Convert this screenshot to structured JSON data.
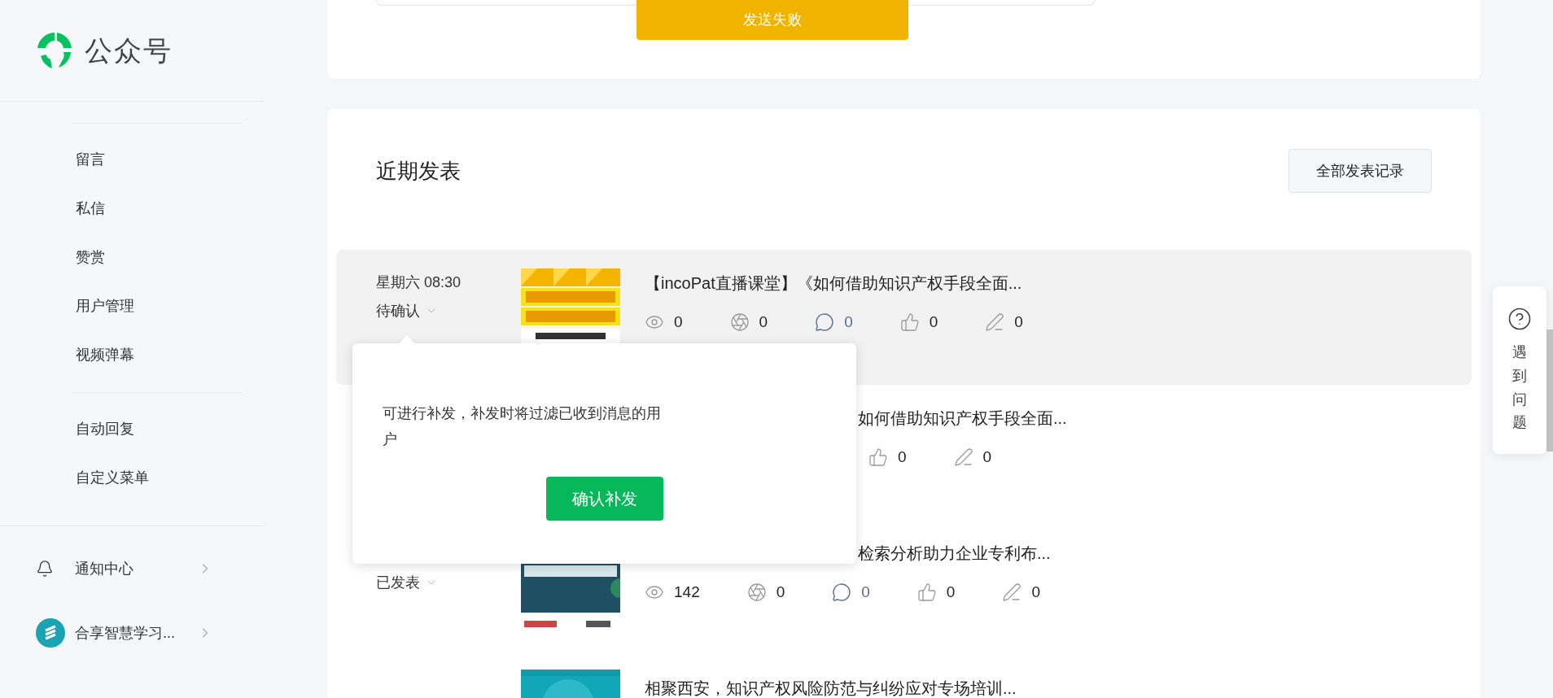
{
  "sidebar": {
    "brand": "公众号",
    "nav_groups": [
      {
        "items": [
          "留言",
          "私信",
          "赞赏",
          "用户管理",
          "视频弹幕"
        ]
      },
      {
        "items": [
          "自动回复",
          "自定义菜单"
        ]
      }
    ],
    "footer": [
      {
        "kind": "bell",
        "label": "通知中心"
      },
      {
        "kind": "account",
        "label": "合享智慧学习..."
      }
    ]
  },
  "send_card": {
    "failed_button": "发送失败"
  },
  "recent": {
    "title": "近期发表",
    "all_button": "全部发表记录",
    "rows": [
      {
        "kind": "full",
        "selected": true,
        "date": "星期六 08:30",
        "status": "待确认",
        "title": "【incoPat直播课堂】《如何借助知识产权手段全面...",
        "stats": [
          {
            "kind": "view",
            "value": "0"
          },
          {
            "kind": "share",
            "value": "0"
          },
          {
            "kind": "comment",
            "value": "0"
          },
          {
            "kind": "like",
            "value": "0"
          },
          {
            "kind": "edit",
            "value": "0"
          }
        ]
      },
      {
        "kind": "covered",
        "selected": false,
        "title": "如何借助知识产权手段全面...",
        "stats": [
          {
            "kind": "like",
            "value": "0"
          },
          {
            "kind": "edit",
            "value": "0"
          }
        ]
      },
      {
        "kind": "status_only",
        "selected": false,
        "status": "已发表",
        "title": "检索分析助力企业专利布...",
        "stats": [
          {
            "kind": "view",
            "value": "142"
          },
          {
            "kind": "share",
            "value": "0"
          },
          {
            "kind": "comment",
            "value": "0"
          },
          {
            "kind": "like",
            "value": "0"
          },
          {
            "kind": "edit",
            "value": "0"
          }
        ]
      },
      {
        "kind": "full",
        "selected": false,
        "title": "相聚西安，知识产权风险防范与纠纷应对专场培训..."
      }
    ]
  },
  "popover": {
    "message": "可进行补发，补发时将过滤已收到消息的用户",
    "confirm_button": "确认补发"
  },
  "help": {
    "label": "遇到问题"
  }
}
